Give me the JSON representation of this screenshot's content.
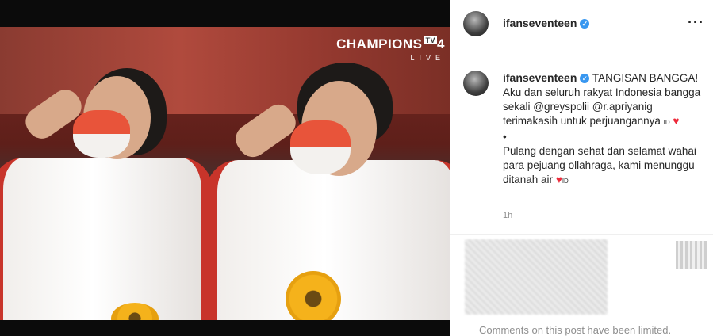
{
  "post": {
    "username": "ifanseventeen",
    "verified_icon": "verified-badge-icon",
    "more_icon": "more-options-icon",
    "overlay": {
      "channel": "CHAMPIONS",
      "badge": "TV",
      "number": "4",
      "live": "LIVE"
    },
    "caption": {
      "headline": "TANGISAN BANGGA!",
      "line1": "Aku dan seluruh rakyat Indonesia bangga sekali @greyspolii @r.apriyanig terimakasih untuk perjuangannya",
      "flag1": "ID",
      "heart1": "♥",
      "bullet": "•",
      "line2": "Pulang dengan sehat dan selamat wahai para pejuang ollahraga, kami menunggu ditanah air",
      "heart2": "♥",
      "flag2": "ID"
    },
    "timestamp": "1h",
    "comments_limited": "Comments on this post have been limited."
  },
  "colors": {
    "verified": "#3897f0",
    "heart": "#ed2a3a",
    "muted": "#8e8e8e",
    "text": "#262626"
  }
}
